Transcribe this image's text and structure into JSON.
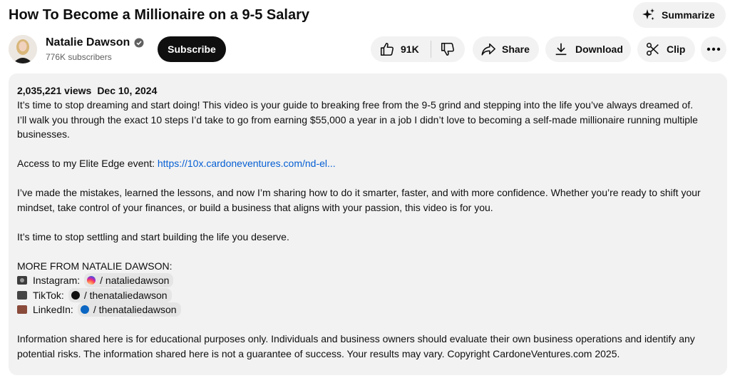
{
  "video": {
    "title": "How To Become a Millionaire on a 9-5 Salary"
  },
  "actions": {
    "summarize_label": "Summarize",
    "like_count": "91K",
    "share_label": "Share",
    "download_label": "Download",
    "clip_label": "Clip",
    "subscribe_label": "Subscribe"
  },
  "channel": {
    "name": "Natalie Dawson",
    "subscribers": "776K subscribers"
  },
  "description": {
    "views": "2,035,221 views",
    "date": "Dec 10, 2024",
    "line1": "It’s time to stop dreaming and start doing! This video is your guide to breaking free from the 9-5 grind and stepping into the life you’ve always dreamed of.",
    "line2": "I’ll walk you through the exact 10 steps I’d take to go from earning $55,000 a year in a job I didn’t love to becoming a self-made millionaire running multiple",
    "line3": "businesses.",
    "access_prefix": "Access to my Elite Edge event: ",
    "access_link": "https://10x.cardoneventures.com/nd-el...",
    "mistakes1": "I’ve made the mistakes, learned the lessons, and now I’m sharing how to do it smarter, faster, and with more confidence. Whether you’re ready to shift your",
    "mistakes2": "mindset, take control of your finances, or build a business that aligns with your passion, this video is for you.",
    "settling": "It’s time to stop settling and start building the life you deserve.",
    "more_heading": "MORE FROM NATALIE DAWSON:",
    "socials": [
      {
        "label": "Instagram:",
        "handle": "/ nataliedawson",
        "icon": "instagram-icon"
      },
      {
        "label": "TikTok:",
        "handle": "/ thenataliedawson",
        "icon": "tiktok-icon"
      },
      {
        "label": "LinkedIn:",
        "handle": "/ thenataliedawson",
        "icon": "linkedin-icon"
      }
    ],
    "disclaimer1": "Information shared here is for educational purposes only. Individuals and business owners should evaluate their own business operations and identify any",
    "disclaimer2": "potential risks. The information shared here is not a guarantee of success. Your results may vary. Copyright CardoneVentures.com 2025."
  },
  "colors": {
    "link": "#065fd4",
    "pill_bg": "#f2f2f2",
    "subscribe_bg": "#0f0f0f"
  }
}
